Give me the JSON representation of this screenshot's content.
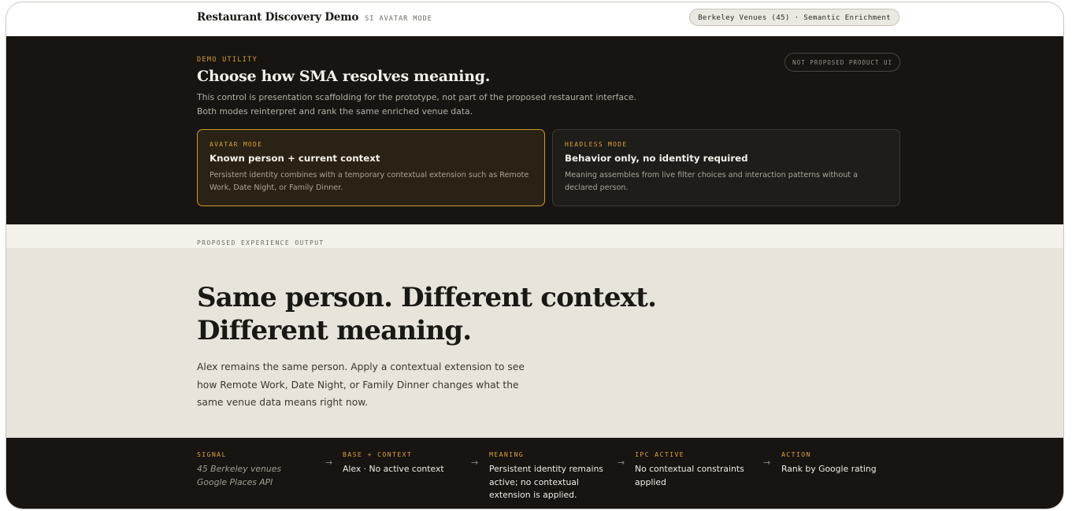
{
  "header": {
    "title": "Restaurant Discovery Demo",
    "mode_tag": "SI AVATAR MODE",
    "pill": "Berkeley Venues (45) · Semantic Enrichment"
  },
  "utility": {
    "eyebrow": "DEMO UTILITY",
    "title": "Choose how SMA resolves meaning.",
    "desc_line1": "This control is presentation scaffolding for the prototype, not part of the proposed restaurant interface.",
    "desc_line2": "Both modes reinterpret and rank the same enriched venue data.",
    "badge": "NOT PROPOSED PRODUCT UI",
    "modes": [
      {
        "eyebrow": "AVATAR MODE",
        "title": "Known person + current context",
        "desc": "Persistent identity combines with a temporary contextual extension such as Remote Work, Date Night, or Family Dinner.",
        "selected": true
      },
      {
        "eyebrow": "HEADLESS MODE",
        "title": "Behavior only, no identity required",
        "desc": "Meaning assembles from live filter choices and interaction patterns without a declared person.",
        "selected": false
      }
    ]
  },
  "output": {
    "label": "PROPOSED EXPERIENCE OUTPUT"
  },
  "hero": {
    "title_line1": "Same person. Different context.",
    "title_line2": "Different meaning.",
    "desc": "Alex remains the same person. Apply a contextual extension to see how Remote Work, Date Night, or Family Dinner changes what the same venue data means right now."
  },
  "pipeline": {
    "arrow_glyph": "→",
    "steps": [
      {
        "eyebrow": "SIGNAL",
        "line1": "45 Berkeley venues",
        "line2": "Google Places API"
      },
      {
        "eyebrow": "BASE + CONTEXT",
        "body": "Alex · No active context"
      },
      {
        "eyebrow": "MEANING",
        "body": "Persistent identity remains active; no contextual extension is applied."
      },
      {
        "eyebrow": "IPC ACTIVE",
        "body": "No contextual constraints applied"
      },
      {
        "eyebrow": "ACTION",
        "body": "Rank by Google rating"
      }
    ]
  },
  "colors": {
    "accent": "#d9a036",
    "dark_band": "#171411",
    "hero_bg": "#e8e4dc"
  }
}
